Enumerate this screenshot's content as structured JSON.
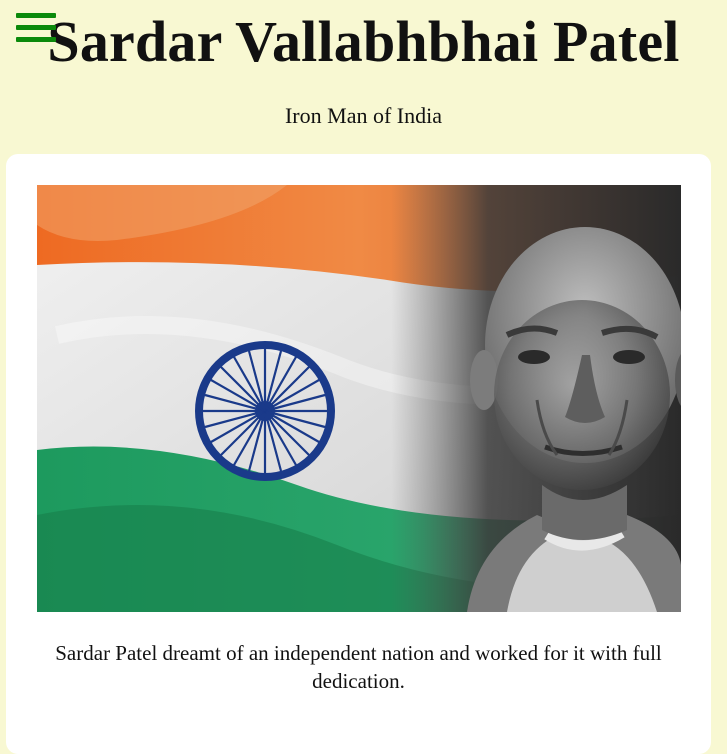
{
  "header": {
    "title": "Sardar Vallabhbhai Patel",
    "subtitle": "Iron Man of India",
    "menu_icon": "hamburger-menu-icon",
    "menu_color": "#0b8a0b"
  },
  "card": {
    "image": {
      "subject": "portrait-with-indian-flag"
    },
    "caption": "Sardar Patel dreamt of an independent nation and worked for it with full dedication."
  },
  "colors": {
    "background": "#f8f8d2",
    "card": "#ffffff",
    "saffron": "#e8662a",
    "green": "#1f8f5a",
    "chakra": "#1a3a8a"
  }
}
